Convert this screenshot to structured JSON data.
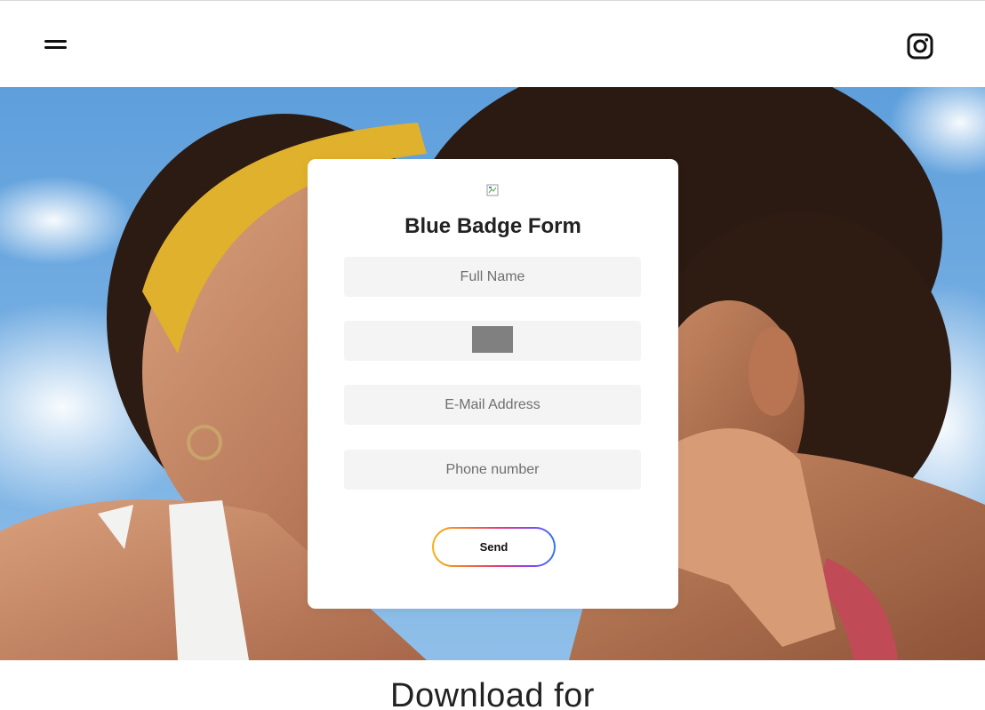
{
  "header": {
    "menu_icon": "hamburger-menu-icon",
    "social_icon": "instagram-icon"
  },
  "form": {
    "title": "Blue Badge Form",
    "full_name_placeholder": "Full Name",
    "captcha_image": "captcha-image",
    "email_placeholder": "E-Mail Address",
    "phone_placeholder": "Phone number",
    "send_label": "Send"
  },
  "footer": {
    "heading": "Download for"
  },
  "colors": {
    "sky": "#6aa7dd",
    "card": "#ffffff",
    "field": "#f4f4f4",
    "headband": "#e0b12d"
  }
}
